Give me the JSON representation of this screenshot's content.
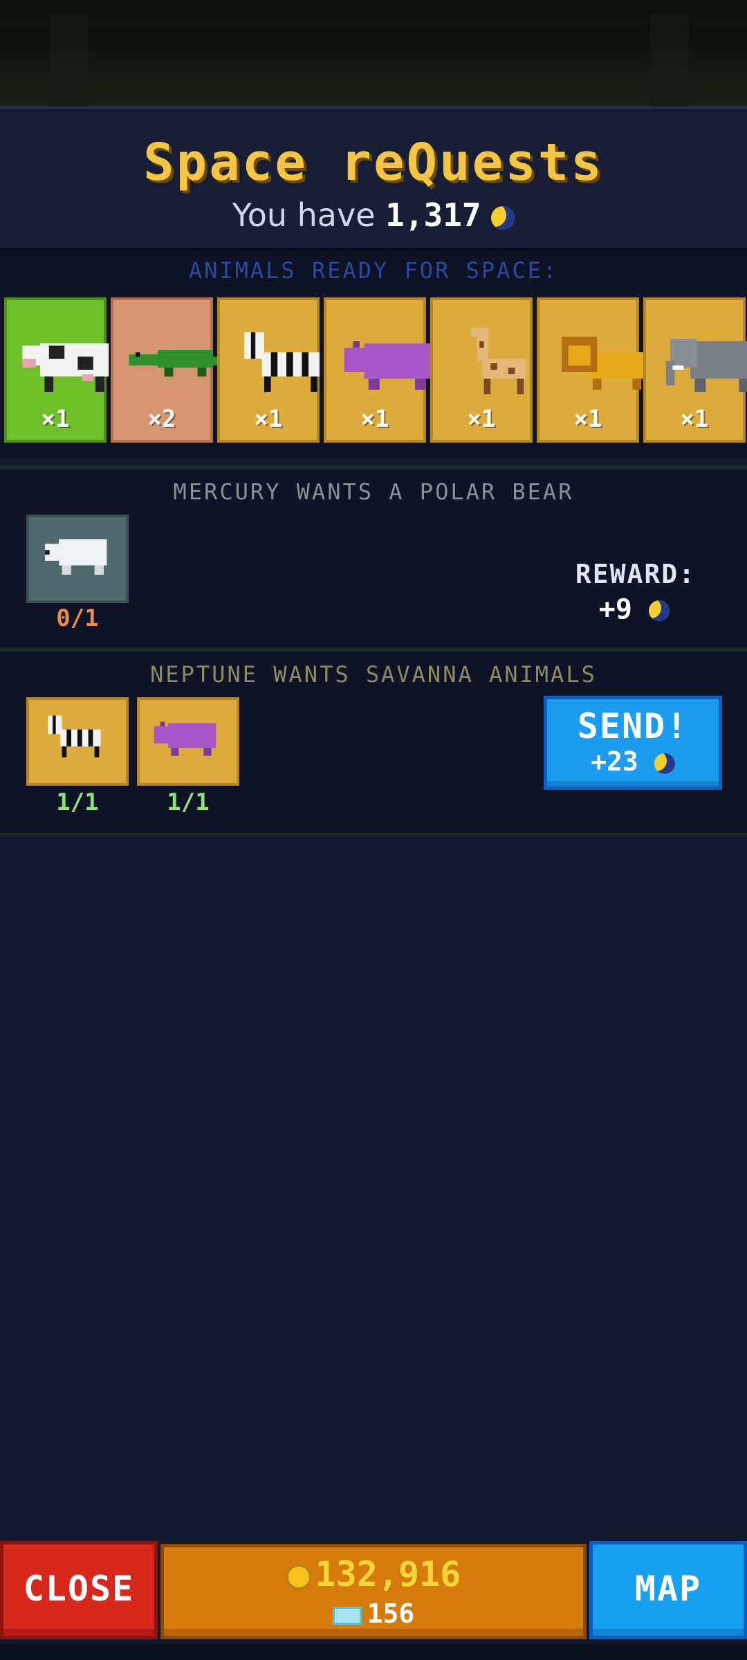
{
  "header": {
    "title": "Space reQuests",
    "balance_prefix": "You have",
    "balance_value": "1,317",
    "currency_icon": "moon-token-icon"
  },
  "ready": {
    "label": "ANIMALS READY FOR SPACE:",
    "animals": [
      {
        "name": "cow",
        "count": "×1",
        "tile": "green"
      },
      {
        "name": "crocodile",
        "count": "×2",
        "tile": "tan"
      },
      {
        "name": "zebra",
        "count": "×1",
        "tile": "gold"
      },
      {
        "name": "hippo",
        "count": "×1",
        "tile": "gold"
      },
      {
        "name": "giraffe",
        "count": "×1",
        "tile": "gold"
      },
      {
        "name": "lion",
        "count": "×1",
        "tile": "gold"
      },
      {
        "name": "elephant",
        "count": "×1",
        "tile": "gold"
      }
    ]
  },
  "requests": [
    {
      "title": "MERCURY WANTS A POLAR BEAR",
      "items": [
        {
          "name": "polar-bear",
          "progress": "0/1"
        }
      ],
      "reward_label": "REWARD:",
      "reward_value": "+9"
    },
    {
      "title": "NEPTUNE WANTS SAVANNA ANIMALS",
      "items": [
        {
          "name": "zebra",
          "progress": "1/1"
        },
        {
          "name": "hippo",
          "progress": "1/1"
        }
      ],
      "send_label": "SEND!",
      "send_reward": "+23"
    }
  ],
  "bottom": {
    "close_label": "CLOSE",
    "coins": "132,916",
    "gems": "156",
    "map_label": "MAP"
  },
  "colors": {
    "title": "#f6c544",
    "send": "#1b9cf0",
    "close": "#d8271c",
    "map": "#17a0ef",
    "currency_bar": "#d67a0b",
    "progress_incomplete": "#f08a4f",
    "progress_complete": "#8fe07a"
  }
}
